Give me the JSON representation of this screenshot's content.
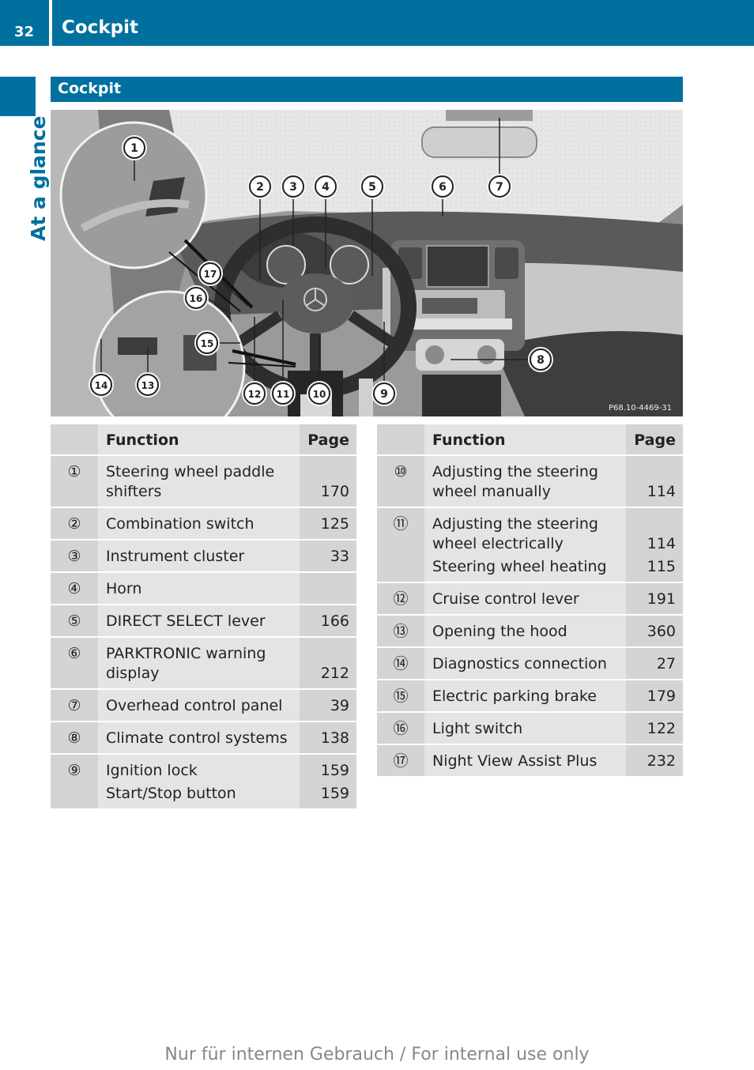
{
  "header": {
    "page_number": "32",
    "chapter_title": "Cockpit"
  },
  "side_tab": {
    "label": "At a glance"
  },
  "section": {
    "title": "Cockpit"
  },
  "figure": {
    "reference_code": "P68.10-4469-31",
    "callouts": [
      "1",
      "2",
      "3",
      "4",
      "5",
      "6",
      "7",
      "8",
      "9",
      "10",
      "11",
      "12",
      "13",
      "14",
      "15",
      "16",
      "17"
    ]
  },
  "colors": {
    "brand_blue": "#00709f",
    "table_dark": "#d4d4d4",
    "table_light": "#e4e4e4"
  },
  "table_left": {
    "headers": {
      "num": "",
      "function": "Function",
      "page": "Page"
    },
    "rows": [
      {
        "num": "①",
        "lines": [
          {
            "text": [
              "Steering wheel paddle",
              "shifters"
            ],
            "page": "170"
          }
        ]
      },
      {
        "num": "②",
        "lines": [
          {
            "text": [
              "Combination switch"
            ],
            "page": "125"
          }
        ]
      },
      {
        "num": "③",
        "lines": [
          {
            "text": [
              "Instrument cluster"
            ],
            "page": "33"
          }
        ]
      },
      {
        "num": "④",
        "lines": [
          {
            "text": [
              "Horn"
            ],
            "page": ""
          }
        ]
      },
      {
        "num": "⑤",
        "lines": [
          {
            "text": [
              "DIRECT SELECT lever"
            ],
            "page": "166"
          }
        ]
      },
      {
        "num": "⑥",
        "lines": [
          {
            "text": [
              "PARKTRONIC warning",
              "display"
            ],
            "page": "212"
          }
        ]
      },
      {
        "num": "⑦",
        "lines": [
          {
            "text": [
              "Overhead control panel"
            ],
            "page": "39"
          }
        ]
      },
      {
        "num": "⑧",
        "lines": [
          {
            "text": [
              "Climate control systems"
            ],
            "page": "138"
          }
        ]
      },
      {
        "num": "⑨",
        "lines": [
          {
            "text": [
              "Ignition lock"
            ],
            "page": "159"
          },
          {
            "text": [
              "Start/Stop button"
            ],
            "page": "159"
          }
        ]
      }
    ]
  },
  "table_right": {
    "headers": {
      "num": "",
      "function": "Function",
      "page": "Page"
    },
    "rows": [
      {
        "num": "⑩",
        "lines": [
          {
            "text": [
              "Adjusting the steering",
              "wheel manually"
            ],
            "page": "114"
          }
        ]
      },
      {
        "num": "⑪",
        "lines": [
          {
            "text": [
              "Adjusting the steering",
              "wheel electrically"
            ],
            "page": "114"
          },
          {
            "text": [
              "Steering wheel heating"
            ],
            "page": "115"
          }
        ]
      },
      {
        "num": "⑫",
        "lines": [
          {
            "text": [
              "Cruise control lever"
            ],
            "page": "191"
          }
        ]
      },
      {
        "num": "⑬",
        "lines": [
          {
            "text": [
              "Opening the hood"
            ],
            "page": "360"
          }
        ]
      },
      {
        "num": "⑭",
        "lines": [
          {
            "text": [
              "Diagnostics connection"
            ],
            "page": "27"
          }
        ]
      },
      {
        "num": "⑮",
        "lines": [
          {
            "text": [
              "Electric parking brake"
            ],
            "page": "179"
          }
        ]
      },
      {
        "num": "⑯",
        "lines": [
          {
            "text": [
              "Light switch"
            ],
            "page": "122"
          }
        ]
      },
      {
        "num": "⑰",
        "lines": [
          {
            "text": [
              "Night View Assist Plus"
            ],
            "page": "232"
          }
        ]
      }
    ]
  },
  "footer": {
    "text": "Nur für internen Gebrauch / For internal use only"
  }
}
